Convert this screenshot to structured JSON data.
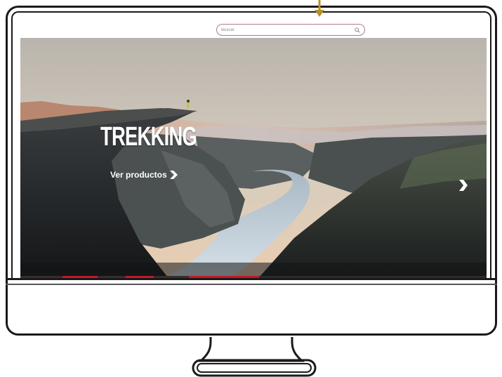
{
  "search": {
    "placeholder": "Buscar"
  },
  "hero": {
    "title": "TREKKING",
    "cta_label": "Ver productos"
  },
  "colors": {
    "accent_pointer": "#b8902a",
    "search_border": "#b07a84",
    "strip_red": "#c01a24",
    "frame": "#1a1a1a"
  },
  "icons": {
    "search": "search-icon",
    "cta": "chevron-right-icon",
    "next": "next-arrow-icon",
    "pointer": "down-arrow-icon"
  }
}
